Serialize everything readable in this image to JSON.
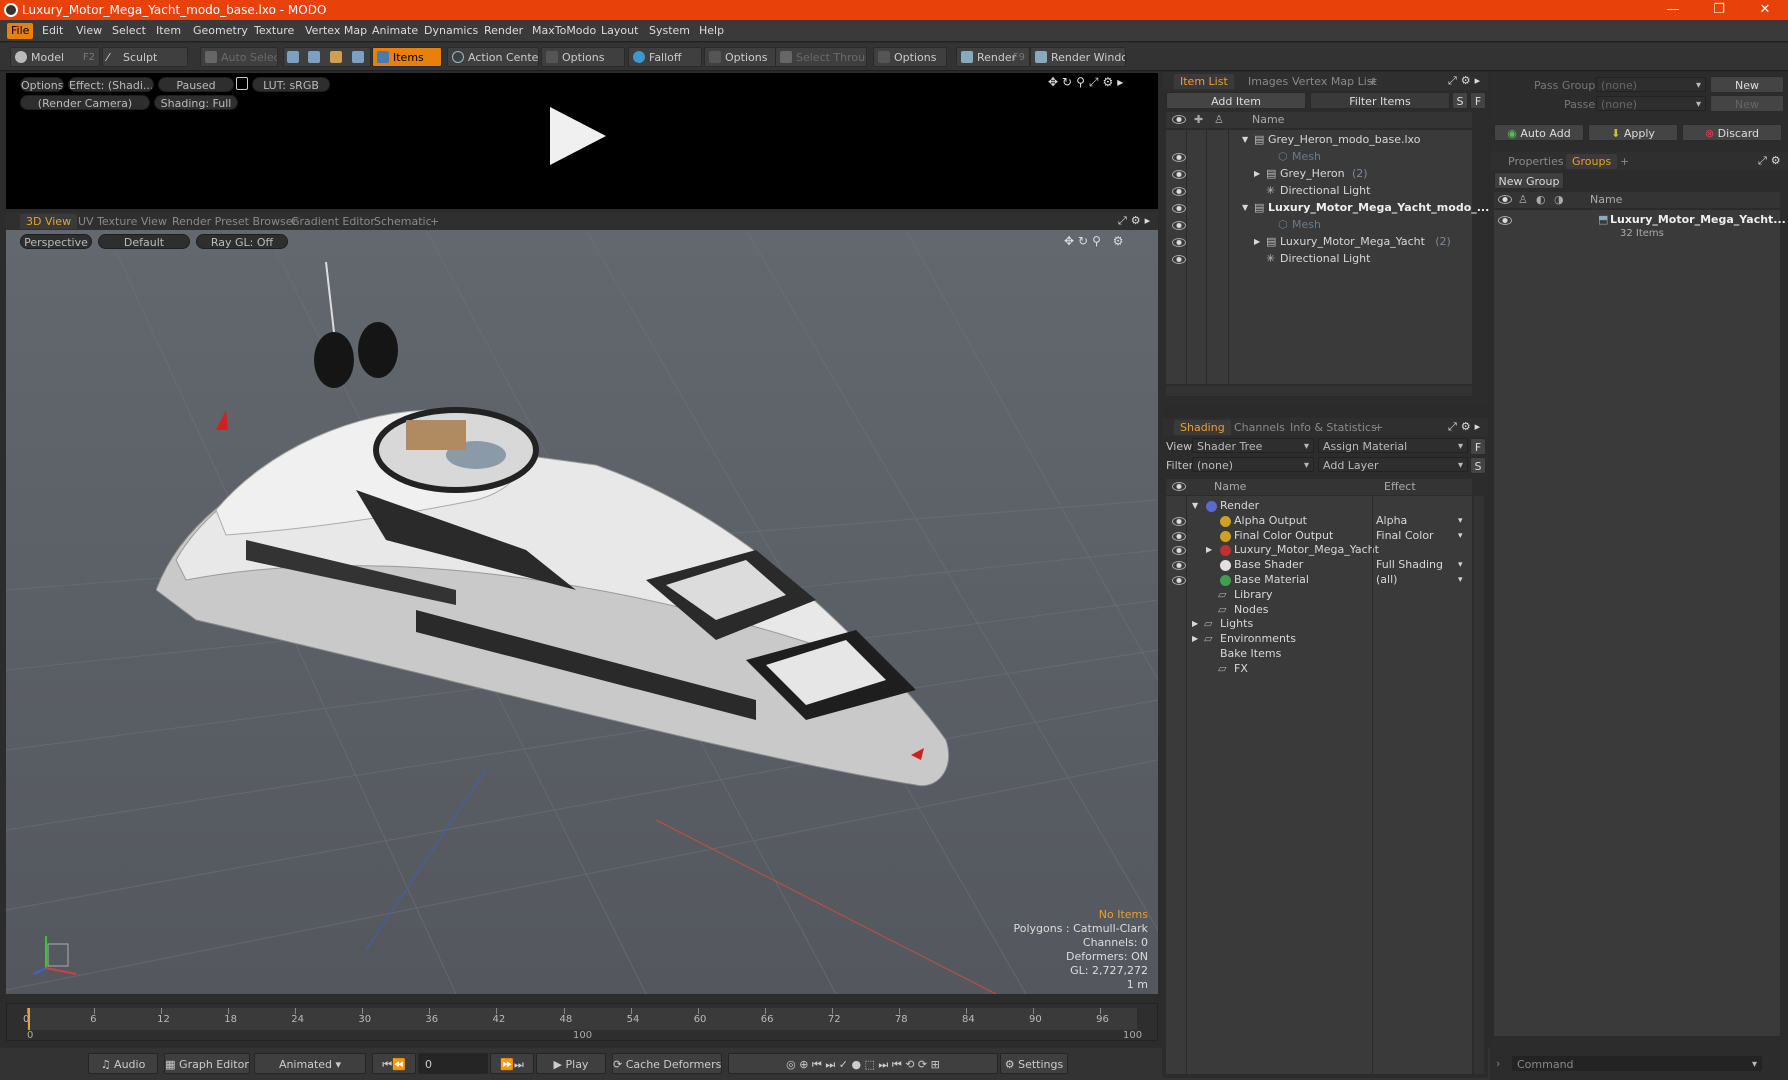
{
  "window": {
    "title": "Luxury_Motor_Mega_Yacht_modo_base.lxo - MODO",
    "minimize": "—",
    "restore": "❐",
    "close": "✕"
  },
  "menu": [
    "File",
    "Edit",
    "View",
    "Select",
    "Item",
    "Geometry",
    "Texture",
    "Vertex Map",
    "Animate",
    "Dynamics",
    "Render",
    "MaxToModo",
    "Layout",
    "System",
    "Help"
  ],
  "toolbar": {
    "model": "Model",
    "model_key": "F2",
    "sculpt": "Sculpt",
    "auto_select": "Auto Select",
    "items": "Items",
    "action_center": "Action Center",
    "options1": "Options",
    "falloff": "Falloff",
    "options2": "Options",
    "select_through": "Select Through",
    "options3": "Options",
    "render": "Render",
    "render_key": "F9",
    "render_window": "Render Window"
  },
  "render_view": {
    "options": "Options",
    "effect": "Effect: (Shadi...",
    "paused": "Paused",
    "lut": "LUT: sRGB",
    "camera": "(Render Camera)",
    "shading": "Shading: Full"
  },
  "viewport_tabs": [
    {
      "label": "3D View",
      "active": true
    },
    {
      "label": "UV Texture View"
    },
    {
      "label": "Render Preset Browser"
    },
    {
      "label": "Gradient Editor"
    },
    {
      "label": "Schematic"
    }
  ],
  "viewport": {
    "projection": "Perspective",
    "style": "Default",
    "raygl": "Ray GL: Off"
  },
  "viewport_info": {
    "no_items": "No Items",
    "polygons": "Polygons : Catmull-Clark",
    "channels": "Channels: 0",
    "deformers": "Deformers: ON",
    "gl": "GL: 2,727,272",
    "scale": "1 m"
  },
  "timeline": {
    "ticks": [
      "0",
      "6",
      "12",
      "18",
      "24",
      "30",
      "36",
      "42",
      "48",
      "54",
      "60",
      "66",
      "72",
      "78",
      "84",
      "90",
      "96"
    ],
    "lower": [
      "0",
      "100",
      "100"
    ]
  },
  "transport": {
    "audio": "Audio",
    "graph_editor": "Graph Editor",
    "animated": "Animated",
    "frame": "0",
    "play": "Play",
    "cache": "Cache Deformers",
    "settings": "Settings"
  },
  "item_list": {
    "tabs": [
      {
        "label": "Item List",
        "active": true
      },
      {
        "label": "Images"
      },
      {
        "label": "Vertex Map List"
      }
    ],
    "add_item": "Add Item",
    "filter": "Filter Items",
    "s": "S",
    "f": "F",
    "col_name": "Name",
    "rows": [
      {
        "label": "Grey_Heron_modo_base.lxo",
        "indent": 0,
        "bold": false,
        "dim": false,
        "arrow": "▼",
        "eye": false
      },
      {
        "label": "Mesh",
        "indent": 2,
        "dim": true,
        "arrow": "",
        "eye": true
      },
      {
        "label": "Grey_Heron",
        "count": "(2)",
        "indent": 1,
        "dim": false,
        "arrow": "▶",
        "eye": true
      },
      {
        "label": "Directional Light",
        "indent": 1,
        "dim": false,
        "arrow": "",
        "eye": true
      },
      {
        "label": "Luxury_Motor_Mega_Yacht_modo_...",
        "indent": 0,
        "bold": true,
        "dim": false,
        "arrow": "▼",
        "eye": true
      },
      {
        "label": "Mesh",
        "indent": 2,
        "dim": true,
        "arrow": "",
        "eye": true
      },
      {
        "label": "Luxury_Motor_Mega_Yacht",
        "count": "(2)",
        "indent": 1,
        "dim": false,
        "arrow": "▶",
        "eye": true
      },
      {
        "label": "Directional Light",
        "indent": 1,
        "dim": false,
        "arrow": "",
        "eye": true
      }
    ]
  },
  "shading": {
    "tabs": [
      {
        "label": "Shading",
        "active": true
      },
      {
        "label": "Channels"
      },
      {
        "label": "Info & Statistics"
      }
    ],
    "view_label": "View",
    "view_value": "Shader Tree",
    "assign": "Assign Material",
    "f": "F",
    "filter_label": "Filter",
    "filter_value": "(none)",
    "add_layer": "Add Layer",
    "s": "S",
    "col_name": "Name",
    "col_effect": "Effect",
    "rows": [
      {
        "label": "Render",
        "effect": "",
        "indent": 0,
        "arrow": "▼",
        "eye": false,
        "icon": "#5a6ad0"
      },
      {
        "label": "Alpha Output",
        "effect": "Alpha",
        "indent": 1,
        "arrow": "",
        "eye": true,
        "icon": "#d0a020"
      },
      {
        "label": "Final Color Output",
        "effect": "Final Color",
        "indent": 1,
        "arrow": "",
        "eye": true,
        "icon": "#d0a020"
      },
      {
        "label": "Luxury_Motor_Mega_Yacht",
        "effect": "",
        "indent": 1,
        "arrow": "▶",
        "eye": true,
        "icon": "#c03030"
      },
      {
        "label": "Base Shader",
        "effect": "Full Shading",
        "indent": 1,
        "arrow": "",
        "eye": true,
        "icon": "#e0e0e0"
      },
      {
        "label": "Base Material",
        "effect": "(all)",
        "indent": 1,
        "arrow": "",
        "eye": true,
        "icon": "#40a050"
      },
      {
        "label": "Library",
        "effect": "",
        "indent": 1,
        "arrow": "",
        "eye": false,
        "icon": ""
      },
      {
        "label": "Nodes",
        "effect": "",
        "indent": 1,
        "arrow": "",
        "eye": false,
        "icon": ""
      },
      {
        "label": "Lights",
        "effect": "",
        "indent": 0,
        "arrow": "▶",
        "eye": false,
        "icon": ""
      },
      {
        "label": "Environments",
        "effect": "",
        "indent": 0,
        "arrow": "▶",
        "eye": false,
        "icon": ""
      },
      {
        "label": "Bake Items",
        "effect": "",
        "indent": 0,
        "arrow": "",
        "eye": false,
        "icon": ""
      },
      {
        "label": "FX",
        "effect": "",
        "indent": 1,
        "arrow": "",
        "eye": false,
        "icon": ""
      }
    ]
  },
  "right_panel": {
    "pass_groups": "Pass Groups",
    "pass_groups_val": "(none)",
    "new": "New",
    "passes": "Passes",
    "passes_val": "(none)",
    "new2": "New",
    "auto_add": "Auto Add",
    "apply": "Apply",
    "discard": "Discard",
    "tabs": [
      {
        "label": "Properties"
      },
      {
        "label": "Groups",
        "active": true
      }
    ],
    "new_group": "New Group",
    "col_name": "Name",
    "group_name": "Luxury_Motor_Mega_Yacht...",
    "group_count": "32 Items",
    "command": "Command"
  }
}
